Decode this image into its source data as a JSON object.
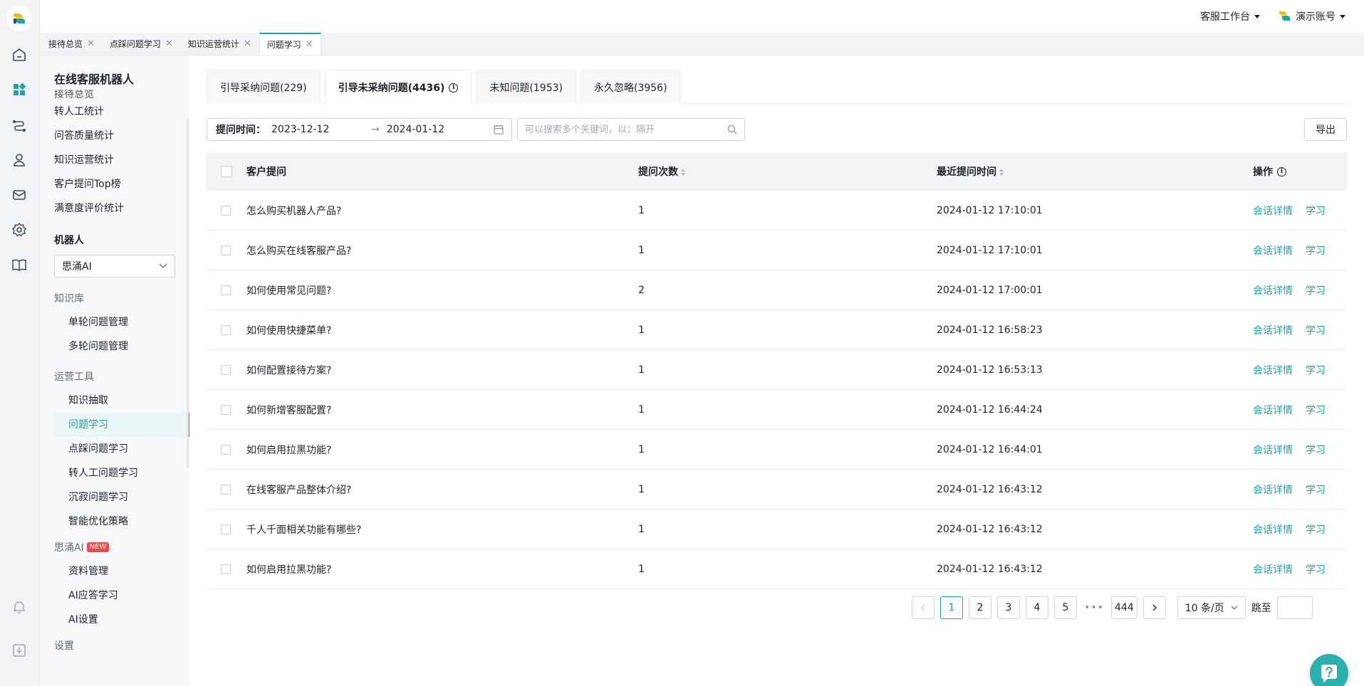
{
  "header": {
    "workspace_label": "客服工作台",
    "account_label": "演示账号"
  },
  "page_tabs": [
    {
      "label": "接待总览"
    },
    {
      "label": "点踩问题学习"
    },
    {
      "label": "知识运营统计"
    },
    {
      "label": "问题学习"
    }
  ],
  "sidebar": {
    "title": "在线客服机器人",
    "cut_item": "接待总览",
    "stats_items": [
      "转人工统计",
      "问答质量统计",
      "知识运营统计",
      "客户提问Top榜",
      "满意度评价统计"
    ],
    "robot_group": "机器人",
    "robot_selected": "思涌AI",
    "kb_group": "知识库",
    "kb_items": [
      "单轮问题管理",
      "多轮问题管理"
    ],
    "ops_group": "运营工具",
    "ops_items": [
      "知识抽取",
      "问题学习",
      "点踩问题学习",
      "转人工问题学习",
      "沉寂问题学习",
      "智能优化策略"
    ],
    "ai_group": "思涌AI",
    "ai_badge": "NEW",
    "ai_items": [
      "资料管理",
      "AI应答学习",
      "AI设置"
    ],
    "settings_group": "设置"
  },
  "question_tabs": [
    {
      "label": "引导采纳问题(229)"
    },
    {
      "label": "引导未采纳问题(4436)"
    },
    {
      "label": "未知问题(1953)"
    },
    {
      "label": "永久忽略(3956)"
    }
  ],
  "filter": {
    "label": "提问时间：",
    "start": "2023-12-12",
    "arrow": "→",
    "end": "2024-01-12",
    "search_placeholder": "可以搜索多个关键词，以；隔开",
    "export_label": "导出"
  },
  "table": {
    "headers": {
      "question": "客户提问",
      "count": "提问次数",
      "time": "最近提问时间",
      "ops": "操作"
    },
    "op_detail": "会话详情",
    "op_learn": "学习",
    "rows": [
      {
        "q": "怎么购买机器人产品?",
        "n": "1",
        "t": "2024-01-12 17:10:01"
      },
      {
        "q": "怎么购买在线客服产品?",
        "n": "1",
        "t": "2024-01-12 17:10:01"
      },
      {
        "q": "如何使用常见问题?",
        "n": "2",
        "t": "2024-01-12 17:00:01"
      },
      {
        "q": "如何使用快捷菜单?",
        "n": "1",
        "t": "2024-01-12 16:58:23"
      },
      {
        "q": "如何配置接待方案?",
        "n": "1",
        "t": "2024-01-12 16:53:13"
      },
      {
        "q": "如何新增客服配置?",
        "n": "1",
        "t": "2024-01-12 16:44:24"
      },
      {
        "q": "如何启用拉黑功能?",
        "n": "1",
        "t": "2024-01-12 16:44:01"
      },
      {
        "q": "在线客服产品整体介绍?",
        "n": "1",
        "t": "2024-01-12 16:43:12"
      },
      {
        "q": "千人千面相关功能有哪些?",
        "n": "1",
        "t": "2024-01-12 16:43:12"
      },
      {
        "q": "如何启用拉黑功能?",
        "n": "1",
        "t": "2024-01-12 16:43:12"
      }
    ]
  },
  "pagination": {
    "pages": [
      "1",
      "2",
      "3",
      "4",
      "5"
    ],
    "ellipsis": "•••",
    "last": "444",
    "size_label": "10 条/页",
    "jump_label": "跳至"
  },
  "colors": {
    "accent": "#1fa3a5",
    "badge_red": "#f04849",
    "fab": "#2bb1ad"
  }
}
